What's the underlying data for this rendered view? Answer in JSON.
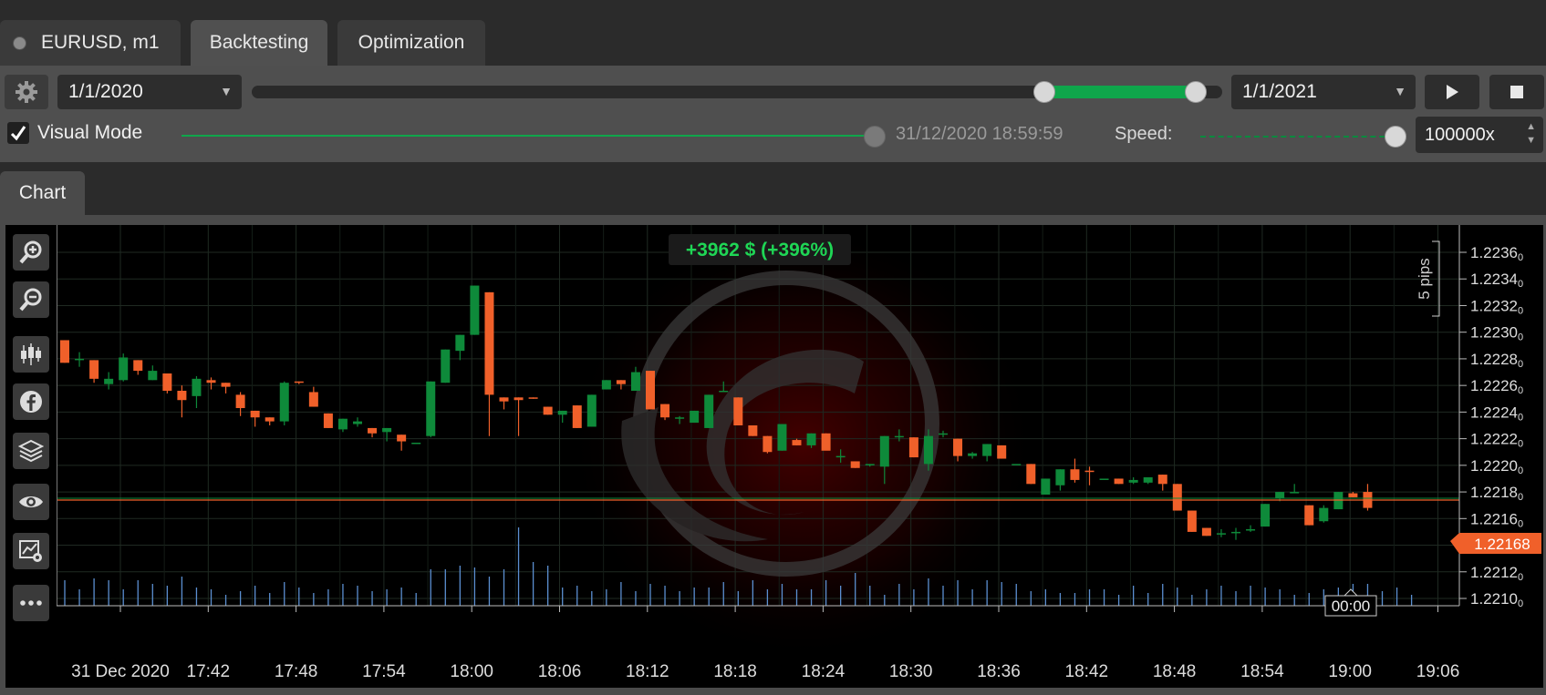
{
  "tabs": [
    {
      "label": "EURUSD, m1",
      "active": false
    },
    {
      "label": "Backtesting",
      "active": true
    },
    {
      "label": "Optimization",
      "active": false
    }
  ],
  "toolbar": {
    "date_from": "1/1/2020",
    "date_to": "1/1/2021",
    "visual_mode_label": "Visual Mode",
    "visual_mode_checked": true,
    "current_time": "31/12/2020 18:59:59",
    "speed_label": "Speed:",
    "speed_value": "100000x"
  },
  "chart_tab": {
    "label": "Chart"
  },
  "icons": [
    "gear-icon",
    "play-icon",
    "stop-icon",
    "zoom-in-icon",
    "zoom-out-icon",
    "chart-type-icon",
    "facebook-icon",
    "layers-icon",
    "eye-icon",
    "object-settings-icon",
    "more-icon"
  ],
  "colors": {
    "bull": "#0e8a3a",
    "bear": "#f0602a",
    "profit": "#1fd655",
    "accent": "#0fa64b"
  },
  "chart_data": {
    "type": "candlestick",
    "profit_label": "+3962 $ (+396%)",
    "pips_label": "5 pips",
    "current_price": "1.22168",
    "cursor_time": "00:00",
    "y_ticks": [
      "1.2236",
      "1.2234",
      "1.2232",
      "1.2230",
      "1.2228",
      "1.2226",
      "1.2224",
      "1.2222",
      "1.2220",
      "1.2218",
      "1.2216",
      "1.2214",
      "1.2212",
      "1.2210"
    ],
    "y_tick_values": [
      1.2236,
      1.2234,
      1.2232,
      1.223,
      1.2228,
      1.2226,
      1.2224,
      1.2222,
      1.222,
      1.2218,
      1.2216,
      1.2214,
      1.2212,
      1.221
    ],
    "ylim": [
      1.2209,
      1.2237
    ],
    "x_ticks": [
      "31 Dec 2020",
      "17:42",
      "17:48",
      "17:54",
      "18:00",
      "18:06",
      "18:12",
      "18:18",
      "18:24",
      "18:30",
      "18:36",
      "18:42",
      "18:48",
      "18:54",
      "19:00",
      "19:06"
    ],
    "candles": [
      [
        1.22294,
        1.22294,
        1.22277,
        1.22277
      ],
      [
        1.2228,
        1.22285,
        1.22274,
        1.2228
      ],
      [
        1.22279,
        1.22279,
        1.22262,
        1.22265
      ],
      [
        1.22261,
        1.2227,
        1.22257,
        1.22265
      ],
      [
        1.22264,
        1.22284,
        1.22263,
        1.22281
      ],
      [
        1.22279,
        1.22279,
        1.22268,
        1.22271
      ],
      [
        1.22264,
        1.22275,
        1.22264,
        1.22271
      ],
      [
        1.22269,
        1.22269,
        1.22254,
        1.22256
      ],
      [
        1.22256,
        1.2226,
        1.22236,
        1.22249
      ],
      [
        1.22252,
        1.22267,
        1.22243,
        1.22265
      ],
      [
        1.22264,
        1.22266,
        1.22257,
        1.22262
      ],
      [
        1.22262,
        1.22262,
        1.22254,
        1.22259
      ],
      [
        1.22253,
        1.22255,
        1.22237,
        1.22243
      ],
      [
        1.22241,
        1.22241,
        1.22229,
        1.22236
      ],
      [
        1.22236,
        1.22236,
        1.2223,
        1.22233
      ],
      [
        1.22233,
        1.22263,
        1.2223,
        1.22262
      ],
      [
        1.22263,
        1.22263,
        1.22261,
        1.22262
      ],
      [
        1.22255,
        1.22259,
        1.22244,
        1.22244
      ],
      [
        1.22239,
        1.22239,
        1.22228,
        1.22228
      ],
      [
        1.22227,
        1.22235,
        1.22225,
        1.22235
      ],
      [
        1.22231,
        1.22236,
        1.22229,
        1.22233
      ],
      [
        1.22228,
        1.22228,
        1.22221,
        1.22224
      ],
      [
        1.22225,
        1.22228,
        1.22218,
        1.22228
      ],
      [
        1.22223,
        1.22223,
        1.22211,
        1.22218
      ],
      [
        1.22217,
        1.22217,
        1.22217,
        1.22217
      ],
      [
        1.22222,
        1.22263,
        1.22221,
        1.22263
      ],
      [
        1.22262,
        1.22287,
        1.22262,
        1.22287
      ],
      [
        1.22286,
        1.22298,
        1.22279,
        1.22298
      ],
      [
        1.22298,
        1.22335,
        1.22298,
        1.22335
      ],
      [
        1.2233,
        1.2233,
        1.22222,
        1.22253
      ],
      [
        1.22251,
        1.22251,
        1.22242,
        1.22248
      ],
      [
        1.22251,
        1.22251,
        1.22222,
        1.22249
      ],
      [
        1.22251,
        1.22251,
        1.2225,
        1.2225
      ],
      [
        1.22244,
        1.22244,
        1.22238,
        1.22238
      ],
      [
        1.22238,
        1.22241,
        1.22232,
        1.22241
      ],
      [
        1.22245,
        1.22245,
        1.22228,
        1.22228
      ],
      [
        1.22229,
        1.22253,
        1.22229,
        1.22253
      ],
      [
        1.22257,
        1.22264,
        1.22257,
        1.22264
      ],
      [
        1.22264,
        1.22264,
        1.22257,
        1.22261
      ],
      [
        1.22256,
        1.22274,
        1.22256,
        1.2227
      ],
      [
        1.22271,
        1.22271,
        1.22242,
        1.22242
      ],
      [
        1.22246,
        1.22246,
        1.22234,
        1.22236
      ],
      [
        1.22236,
        1.22237,
        1.22231,
        1.22236
      ],
      [
        1.22232,
        1.22241,
        1.22232,
        1.22241
      ],
      [
        1.22228,
        1.22253,
        1.22228,
        1.22253
      ],
      [
        1.22256,
        1.22263,
        1.22256,
        1.22256
      ],
      [
        1.22251,
        1.22251,
        1.2223,
        1.2223
      ],
      [
        1.2223,
        1.2223,
        1.22222,
        1.22222
      ],
      [
        1.22222,
        1.22222,
        1.22209,
        1.2221
      ],
      [
        1.22211,
        1.22231,
        1.22211,
        1.22231
      ],
      [
        1.22219,
        1.2222,
        1.22215,
        1.22215
      ],
      [
        1.22215,
        1.22224,
        1.22213,
        1.22224
      ],
      [
        1.22224,
        1.22224,
        1.22213,
        1.22211
      ],
      [
        1.22207,
        1.22212,
        1.22202,
        1.22207
      ],
      [
        1.22203,
        1.22203,
        1.22198,
        1.22198
      ],
      [
        1.22201,
        1.22201,
        1.22199,
        1.22201
      ],
      [
        1.22199,
        1.22222,
        1.22186,
        1.22222
      ],
      [
        1.22222,
        1.22227,
        1.22218,
        1.22222
      ],
      [
        1.22221,
        1.22221,
        1.22206,
        1.22206
      ],
      [
        1.22201,
        1.22227,
        1.22196,
        1.22222
      ],
      [
        1.22224,
        1.22226,
        1.22221,
        1.22224
      ],
      [
        1.2222,
        1.2222,
        1.22203,
        1.22207
      ],
      [
        1.22207,
        1.2221,
        1.22205,
        1.22209
      ],
      [
        1.22207,
        1.22216,
        1.22203,
        1.22216
      ],
      [
        1.22215,
        1.22215,
        1.22205,
        1.22205
      ],
      [
        1.22201,
        1.22201,
        1.22201,
        1.22201
      ],
      [
        1.22201,
        1.22201,
        1.22186,
        1.22186
      ],
      [
        1.22178,
        1.2219,
        1.22178,
        1.2219
      ],
      [
        1.22185,
        1.22197,
        1.22181,
        1.22197
      ],
      [
        1.22197,
        1.22205,
        1.22187,
        1.22189
      ],
      [
        1.22196,
        1.22199,
        1.22185,
        1.22195
      ],
      [
        1.2219,
        1.2219,
        1.2219,
        1.2219
      ],
      [
        1.2219,
        1.2219,
        1.22186,
        1.22186
      ],
      [
        1.22187,
        1.22191,
        1.22186,
        1.22189
      ],
      [
        1.22187,
        1.22191,
        1.22186,
        1.22191
      ],
      [
        1.22193,
        1.22193,
        1.22181,
        1.22186
      ],
      [
        1.22186,
        1.22186,
        1.22166,
        1.22166
      ],
      [
        1.22166,
        1.22166,
        1.2215,
        1.2215
      ],
      [
        1.22153,
        1.22153,
        1.22147,
        1.22147
      ],
      [
        1.22149,
        1.22152,
        1.22146,
        1.22149
      ],
      [
        1.2215,
        1.22153,
        1.22144,
        1.2215
      ],
      [
        1.22152,
        1.22155,
        1.2215,
        1.22152
      ],
      [
        1.22154,
        1.22171,
        1.22154,
        1.22171
      ],
      [
        1.22175,
        1.2218,
        1.22173,
        1.2218
      ],
      [
        1.2218,
        1.22186,
        1.22179,
        1.2218
      ],
      [
        1.2217,
        1.2217,
        1.22155,
        1.22155
      ],
      [
        1.22158,
        1.2217,
        1.22157,
        1.22168
      ],
      [
        1.22167,
        1.2218,
        1.22167,
        1.2218
      ],
      [
        1.22179,
        1.2218,
        1.22176,
        1.22176
      ],
      [
        1.2218,
        1.22186,
        1.22166,
        1.22168
      ]
    ],
    "volume": [
      28,
      18,
      30,
      28,
      18,
      28,
      24,
      22,
      32,
      20,
      18,
      12,
      16,
      22,
      14,
      26,
      20,
      14,
      18,
      24,
      22,
      16,
      18,
      20,
      14,
      40,
      40,
      44,
      42,
      32,
      40,
      86,
      48,
      44,
      20,
      22,
      16,
      18,
      26,
      16,
      24,
      22,
      16,
      20,
      20,
      26,
      16,
      28,
      18,
      24,
      18,
      18,
      28,
      22,
      36,
      22,
      12,
      24,
      18,
      30,
      22,
      28,
      18,
      28,
      26,
      24,
      16,
      18,
      14,
      14,
      18,
      18,
      12,
      22,
      14,
      24,
      20,
      12,
      18,
      22,
      16,
      22,
      20,
      18,
      12,
      14,
      18,
      20,
      24,
      24,
      16,
      20,
      12
    ]
  }
}
